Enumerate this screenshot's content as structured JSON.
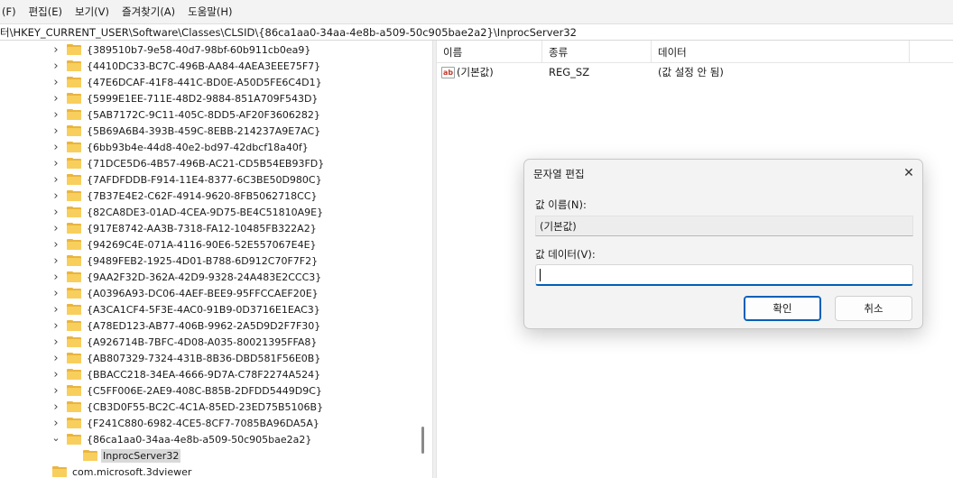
{
  "menubar": {
    "items": [
      "(F)",
      "편집(E)",
      "보기(V)",
      "즐겨찾기(A)",
      "도움말(H)"
    ]
  },
  "address": {
    "path": "터\\HKEY_CURRENT_USER\\Software\\Classes\\CLSID\\{86ca1aa0-34aa-4e8b-a509-50c905bae2a2}\\InprocServer32"
  },
  "tree": {
    "items": [
      {
        "label": "{389510b7-9e58-40d7-98bf-60b911cb0ea9}",
        "state": "collapsed"
      },
      {
        "label": "{4410DC33-BC7C-496B-AA84-4AEA3EEE75F7}",
        "state": "collapsed"
      },
      {
        "label": "{47E6DCAF-41F8-441C-BD0E-A50D5FE6C4D1}",
        "state": "collapsed"
      },
      {
        "label": "{5999E1EE-711E-48D2-9884-851A709F543D}",
        "state": "collapsed"
      },
      {
        "label": "{5AB7172C-9C11-405C-8DD5-AF20F3606282}",
        "state": "collapsed"
      },
      {
        "label": "{5B69A6B4-393B-459C-8EBB-214237A9E7AC}",
        "state": "collapsed"
      },
      {
        "label": "{6bb93b4e-44d8-40e2-bd97-42dbcf18a40f}",
        "state": "collapsed"
      },
      {
        "label": "{71DCE5D6-4B57-496B-AC21-CD5B54EB93FD}",
        "state": "collapsed"
      },
      {
        "label": "{7AFDFDDB-F914-11E4-8377-6C3BE50D980C}",
        "state": "collapsed"
      },
      {
        "label": "{7B37E4E2-C62F-4914-9620-8FB5062718CC}",
        "state": "collapsed"
      },
      {
        "label": "{82CA8DE3-01AD-4CEA-9D75-BE4C51810A9E}",
        "state": "collapsed"
      },
      {
        "label": "{917E8742-AA3B-7318-FA12-10485FB322A2}",
        "state": "collapsed"
      },
      {
        "label": "{94269C4E-071A-4116-90E6-52E557067E4E}",
        "state": "collapsed"
      },
      {
        "label": "{9489FEB2-1925-4D01-B788-6D912C70F7F2}",
        "state": "collapsed"
      },
      {
        "label": "{9AA2F32D-362A-42D9-9328-24A483E2CCC3}",
        "state": "collapsed"
      },
      {
        "label": "{A0396A93-DC06-4AEF-BEE9-95FFCCAEF20E}",
        "state": "collapsed"
      },
      {
        "label": "{A3CA1CF4-5F3E-4AC0-91B9-0D3716E1EAC3}",
        "state": "collapsed"
      },
      {
        "label": "{A78ED123-AB77-406B-9962-2A5D9D2F7F30}",
        "state": "collapsed"
      },
      {
        "label": "{A926714B-7BFC-4D08-A035-80021395FFA8}",
        "state": "collapsed"
      },
      {
        "label": "{AB807329-7324-431B-8B36-DBD581F56E0B}",
        "state": "collapsed"
      },
      {
        "label": "{BBACC218-34EA-4666-9D7A-C78F2274A524}",
        "state": "collapsed"
      },
      {
        "label": "{C5FF006E-2AE9-408C-B85B-2DFDD5449D9C}",
        "state": "collapsed"
      },
      {
        "label": "{CB3D0F55-BC2C-4C1A-85ED-23ED75B5106B}",
        "state": "collapsed"
      },
      {
        "label": "{F241C880-6982-4CE5-8CF7-7085BA96DA5A}",
        "state": "collapsed"
      },
      {
        "label": "{86ca1aa0-34aa-4e8b-a509-50c905bae2a2}",
        "state": "expanded"
      },
      {
        "label": "InprocServer32",
        "state": "selected-child"
      },
      {
        "label": "com.microsoft.3dviewer",
        "state": "parent-level"
      }
    ]
  },
  "list": {
    "columns": [
      "이름",
      "종류",
      "데이터"
    ],
    "rows": [
      {
        "name": "(기본값)",
        "type": "REG_SZ",
        "data": "(값 설정 안 됨)"
      }
    ]
  },
  "dialog": {
    "title": "문자열 편집",
    "name_label": "값 이름(N):",
    "name_value": "(기본값)",
    "data_label": "값 데이터(V):",
    "data_value": "",
    "ok": "확인",
    "cancel": "취소",
    "close_icon": "close-icon"
  }
}
